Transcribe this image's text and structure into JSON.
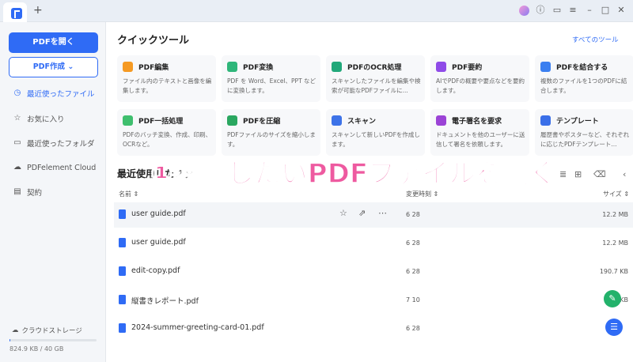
{
  "sidebar": {
    "open_pdf_label": "PDFを開く",
    "create_pdf_label": "PDF作成",
    "items": [
      {
        "label": "最近使ったファイル",
        "icon": "clock-icon"
      },
      {
        "label": "お気に入り",
        "icon": "star-icon"
      },
      {
        "label": "最近使ったフォルダ",
        "icon": "folder-icon"
      },
      {
        "label": "PDFelement Cloud",
        "icon": "cloud-icon"
      },
      {
        "label": "契約",
        "icon": "document-icon"
      }
    ],
    "storage_label": "クラウドストレージ",
    "storage_size": "824.9 KB / 40 GB",
    "storage_used_fraction": 2e-05
  },
  "main": {
    "title": "クイックツール",
    "all_tools_label": "すべてのツール",
    "tools": [
      {
        "name": "PDF編集",
        "desc": "ファイル内のテキストと画像を編集します。",
        "color": "#f59a23"
      },
      {
        "name": "PDF変換",
        "desc": "PDF を Word、Excel、PPT などに変換します。",
        "color": "#2fb67a"
      },
      {
        "name": "PDFのOCR処理",
        "desc": "スキャンしたファイルを編集や検索が可能なPDFファイルに...",
        "color": "#21a87a"
      },
      {
        "name": "PDF要約",
        "desc": "AIでPDFの概要や要点などを要約します。",
        "color": "#8f4be8"
      },
      {
        "name": "PDFを結合する",
        "desc": "複数のファイルを1つのPDFに結合します。",
        "color": "#3b7ff0"
      },
      {
        "name": "PDF一括処理",
        "desc": "PDFのバッチ変換、作成、印刷、OCRなど。",
        "color": "#3fbf6e"
      },
      {
        "name": "PDFを圧縮",
        "desc": "PDFファイルのサイズを縮小します。",
        "color": "#2aa760"
      },
      {
        "name": "スキャン",
        "desc": "スキャンして新しいPDFを作成します。",
        "color": "#3d73e8"
      },
      {
        "name": "電子署名を要求",
        "desc": "ドキュメントを他のユーザーに送信して署名を依頼します。",
        "color": "#9b43d6"
      },
      {
        "name": "テンプレート",
        "desc": "履歴書やポスターなど、それぞれに応じたPDFテンプレート...",
        "color": "#3a6fe8"
      }
    ],
    "recent_title": "最近使用したファ",
    "overlay_text": "①変換したいPDFファイルを開く",
    "columns": {
      "name": "名前",
      "date": "変更時刻",
      "size": "サイズ"
    },
    "files": [
      {
        "name": "user guide.pdf",
        "date": "6 28",
        "size": "12.2 MB"
      },
      {
        "name": "user guide.pdf",
        "date": "6 28",
        "size": "12.2 MB"
      },
      {
        "name": "edit-copy.pdf",
        "date": "6 28",
        "size": "190.7 KB"
      },
      {
        "name": "縦書きレポート.pdf",
        "date": "7 10",
        "size": "7.0 KB"
      },
      {
        "name": "2024-summer-greeting-card-01.pdf",
        "date": "6 28",
        "size": ""
      }
    ]
  }
}
